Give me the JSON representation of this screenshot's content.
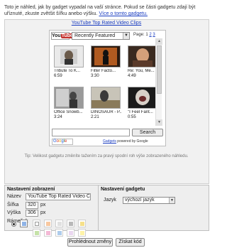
{
  "intro": {
    "text": "Toto je náhled, jak by gadget vypadal na vaší stránce. Pokud se části gadgetu zdají být uříznuté, zkuste zvětšit šířku anebo výšku.",
    "link": "Více o tomto gadgetu."
  },
  "gadget": {
    "title": "YouTube Top Rated Video Clips",
    "logo_you": "You",
    "logo_tube": "Tube",
    "feed_select": "Recently Featured",
    "page_label": "Page:",
    "pages": [
      "1",
      "2",
      "3"
    ],
    "videos": [
      {
        "title": "Tribute To K...",
        "duration": "6:59"
      },
      {
        "title": "Filter Facto...",
        "duration": "3:30"
      },
      {
        "title": "Re: You, Me...",
        "duration": "4:49"
      },
      {
        "title": "Office Snowb...",
        "duration": "3:24"
      },
      {
        "title": "DINOSAUR - P...",
        "duration": "2:21"
      },
      {
        "title": "\"I Feel Fant...",
        "duration": "0:55"
      }
    ],
    "search_button": "Search",
    "google_logo": [
      "G",
      "o",
      "o",
      "g",
      "l",
      "e"
    ],
    "gadgets_link": "Gadgets",
    "powered_by": "powered by Google"
  },
  "tip": "Tip: Velikost gadgetu změníte tažením za pravý spodní roh výše zobrazeného náhledu.",
  "display_settings": {
    "title": "Nastavení zobrazení",
    "name_label": "Název",
    "name_value": "YouTube Top Rated Video Clip",
    "width_label": "Šířka",
    "width_value": "320",
    "width_unit": "px",
    "height_label": "Výška",
    "height_value": "306",
    "height_unit": "px",
    "border_label": "Rámeček"
  },
  "gadget_settings": {
    "title": "Nastavení gadgetu",
    "language_label": "Jazyk",
    "language_value": "výchozí jazyk"
  },
  "buttons": {
    "preview": "Prohlédnout změny",
    "get_code": "Získat kód"
  },
  "colors": {
    "link": "#1a3dc1",
    "panel_bg": "#eeeeee",
    "youtube_red": "#c4302b",
    "border_swatches": [
      "#ffffff",
      "#8fb3e6",
      "#ffffff",
      "#f8c8a0",
      "#e0e0e0",
      "#b8b8b8",
      "#f6e08a",
      "#c5e2a8",
      "#f4b9d6",
      "#aeccec",
      "#ead7f0",
      "#fff4a8"
    ]
  }
}
